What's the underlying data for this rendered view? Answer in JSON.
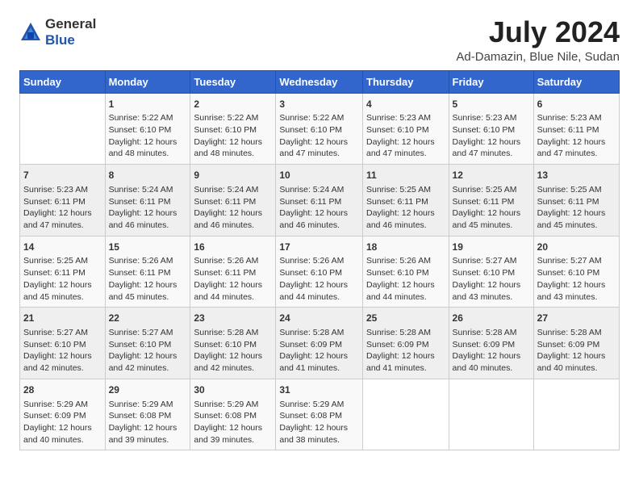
{
  "header": {
    "logo_general": "General",
    "logo_blue": "Blue",
    "month": "July 2024",
    "location": "Ad-Damazin, Blue Nile, Sudan"
  },
  "days_of_week": [
    "Sunday",
    "Monday",
    "Tuesday",
    "Wednesday",
    "Thursday",
    "Friday",
    "Saturday"
  ],
  "weeks": [
    [
      {
        "day": "",
        "info": ""
      },
      {
        "day": "1",
        "info": "Sunrise: 5:22 AM\nSunset: 6:10 PM\nDaylight: 12 hours\nand 48 minutes."
      },
      {
        "day": "2",
        "info": "Sunrise: 5:22 AM\nSunset: 6:10 PM\nDaylight: 12 hours\nand 48 minutes."
      },
      {
        "day": "3",
        "info": "Sunrise: 5:22 AM\nSunset: 6:10 PM\nDaylight: 12 hours\nand 47 minutes."
      },
      {
        "day": "4",
        "info": "Sunrise: 5:23 AM\nSunset: 6:10 PM\nDaylight: 12 hours\nand 47 minutes."
      },
      {
        "day": "5",
        "info": "Sunrise: 5:23 AM\nSunset: 6:10 PM\nDaylight: 12 hours\nand 47 minutes."
      },
      {
        "day": "6",
        "info": "Sunrise: 5:23 AM\nSunset: 6:11 PM\nDaylight: 12 hours\nand 47 minutes."
      }
    ],
    [
      {
        "day": "7",
        "info": "Sunrise: 5:23 AM\nSunset: 6:11 PM\nDaylight: 12 hours\nand 47 minutes."
      },
      {
        "day": "8",
        "info": "Sunrise: 5:24 AM\nSunset: 6:11 PM\nDaylight: 12 hours\nand 46 minutes."
      },
      {
        "day": "9",
        "info": "Sunrise: 5:24 AM\nSunset: 6:11 PM\nDaylight: 12 hours\nand 46 minutes."
      },
      {
        "day": "10",
        "info": "Sunrise: 5:24 AM\nSunset: 6:11 PM\nDaylight: 12 hours\nand 46 minutes."
      },
      {
        "day": "11",
        "info": "Sunrise: 5:25 AM\nSunset: 6:11 PM\nDaylight: 12 hours\nand 46 minutes."
      },
      {
        "day": "12",
        "info": "Sunrise: 5:25 AM\nSunset: 6:11 PM\nDaylight: 12 hours\nand 45 minutes."
      },
      {
        "day": "13",
        "info": "Sunrise: 5:25 AM\nSunset: 6:11 PM\nDaylight: 12 hours\nand 45 minutes."
      }
    ],
    [
      {
        "day": "14",
        "info": "Sunrise: 5:25 AM\nSunset: 6:11 PM\nDaylight: 12 hours\nand 45 minutes."
      },
      {
        "day": "15",
        "info": "Sunrise: 5:26 AM\nSunset: 6:11 PM\nDaylight: 12 hours\nand 45 minutes."
      },
      {
        "day": "16",
        "info": "Sunrise: 5:26 AM\nSunset: 6:11 PM\nDaylight: 12 hours\nand 44 minutes."
      },
      {
        "day": "17",
        "info": "Sunrise: 5:26 AM\nSunset: 6:10 PM\nDaylight: 12 hours\nand 44 minutes."
      },
      {
        "day": "18",
        "info": "Sunrise: 5:26 AM\nSunset: 6:10 PM\nDaylight: 12 hours\nand 44 minutes."
      },
      {
        "day": "19",
        "info": "Sunrise: 5:27 AM\nSunset: 6:10 PM\nDaylight: 12 hours\nand 43 minutes."
      },
      {
        "day": "20",
        "info": "Sunrise: 5:27 AM\nSunset: 6:10 PM\nDaylight: 12 hours\nand 43 minutes."
      }
    ],
    [
      {
        "day": "21",
        "info": "Sunrise: 5:27 AM\nSunset: 6:10 PM\nDaylight: 12 hours\nand 42 minutes."
      },
      {
        "day": "22",
        "info": "Sunrise: 5:27 AM\nSunset: 6:10 PM\nDaylight: 12 hours\nand 42 minutes."
      },
      {
        "day": "23",
        "info": "Sunrise: 5:28 AM\nSunset: 6:10 PM\nDaylight: 12 hours\nand 42 minutes."
      },
      {
        "day": "24",
        "info": "Sunrise: 5:28 AM\nSunset: 6:09 PM\nDaylight: 12 hours\nand 41 minutes."
      },
      {
        "day": "25",
        "info": "Sunrise: 5:28 AM\nSunset: 6:09 PM\nDaylight: 12 hours\nand 41 minutes."
      },
      {
        "day": "26",
        "info": "Sunrise: 5:28 AM\nSunset: 6:09 PM\nDaylight: 12 hours\nand 40 minutes."
      },
      {
        "day": "27",
        "info": "Sunrise: 5:28 AM\nSunset: 6:09 PM\nDaylight: 12 hours\nand 40 minutes."
      }
    ],
    [
      {
        "day": "28",
        "info": "Sunrise: 5:29 AM\nSunset: 6:09 PM\nDaylight: 12 hours\nand 40 minutes."
      },
      {
        "day": "29",
        "info": "Sunrise: 5:29 AM\nSunset: 6:08 PM\nDaylight: 12 hours\nand 39 minutes."
      },
      {
        "day": "30",
        "info": "Sunrise: 5:29 AM\nSunset: 6:08 PM\nDaylight: 12 hours\nand 39 minutes."
      },
      {
        "day": "31",
        "info": "Sunrise: 5:29 AM\nSunset: 6:08 PM\nDaylight: 12 hours\nand 38 minutes."
      },
      {
        "day": "",
        "info": ""
      },
      {
        "day": "",
        "info": ""
      },
      {
        "day": "",
        "info": ""
      }
    ]
  ]
}
